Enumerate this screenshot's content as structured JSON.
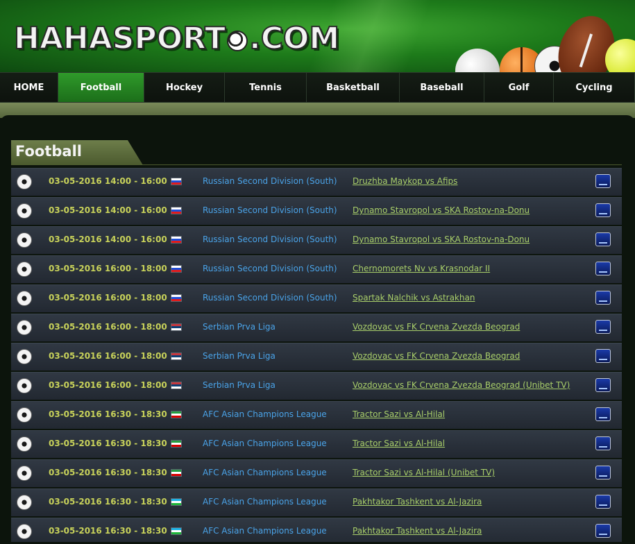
{
  "header": {
    "logo_text_left": "HAHASPORT",
    "logo_text_right": ".COM"
  },
  "nav": [
    {
      "label": "HOME",
      "active": false
    },
    {
      "label": "Football",
      "active": true
    },
    {
      "label": "Hockey",
      "active": false
    },
    {
      "label": "Tennis",
      "active": false
    },
    {
      "label": "Basketball",
      "active": false
    },
    {
      "label": "Baseball",
      "active": false
    },
    {
      "label": "Golf",
      "active": false
    },
    {
      "label": "Cycling",
      "active": false
    }
  ],
  "section": {
    "title": "Football"
  },
  "flag_colors": {
    "russia": [
      "#ffffff",
      "#1f4fd8",
      "#e21b1b"
    ],
    "serbia": [
      "#c6363c",
      "#0c4076",
      "#ffffff"
    ],
    "iran": [
      "#239f40",
      "#ffffff",
      "#da0000"
    ],
    "uzbekistan": [
      "#1eb4e6",
      "#ffffff",
      "#1eb53a"
    ]
  },
  "events": [
    {
      "time": "03-05-2016 14:00 - 16:00",
      "flag": "russia",
      "league": "Russian Second Division (South)",
      "match": "Druzhba Maykop vs Afips"
    },
    {
      "time": "03-05-2016 14:00 - 16:00",
      "flag": "russia",
      "league": "Russian Second Division (South)",
      "match": "Dynamo Stavropol vs SKA Rostov-na-Donu"
    },
    {
      "time": "03-05-2016 14:00 - 16:00",
      "flag": "russia",
      "league": "Russian Second Division (South)",
      "match": "Dynamo Stavropol vs SKA Rostov-na-Donu"
    },
    {
      "time": "03-05-2016 16:00 - 18:00",
      "flag": "russia",
      "league": "Russian Second Division (South)",
      "match": "Chernomorets Nv vs Krasnodar II"
    },
    {
      "time": "03-05-2016 16:00 - 18:00",
      "flag": "russia",
      "league": "Russian Second Division (South)",
      "match": "Spartak Nalchik vs Astrakhan"
    },
    {
      "time": "03-05-2016 16:00 - 18:00",
      "flag": "serbia",
      "league": "Serbian Prva Liga",
      "match": "Vozdovac vs FK Crvena Zvezda Beograd"
    },
    {
      "time": "03-05-2016 16:00 - 18:00",
      "flag": "serbia",
      "league": "Serbian Prva Liga",
      "match": "Vozdovac vs FK Crvena Zvezda Beograd"
    },
    {
      "time": "03-05-2016 16:00 - 18:00",
      "flag": "serbia",
      "league": "Serbian Prva Liga",
      "match": "Vozdovac vs FK Crvena Zvezda Beograd (Unibet TV)"
    },
    {
      "time": "03-05-2016 16:30 - 18:30",
      "flag": "iran",
      "league": "AFC Asian Champions League",
      "match": "Tractor Sazi vs Al-Hilal"
    },
    {
      "time": "03-05-2016 16:30 - 18:30",
      "flag": "iran",
      "league": "AFC Asian Champions League",
      "match": "Tractor Sazi vs Al-Hilal"
    },
    {
      "time": "03-05-2016 16:30 - 18:30",
      "flag": "iran",
      "league": "AFC Asian Champions League",
      "match": "Tractor Sazi vs Al-Hilal (Unibet TV)"
    },
    {
      "time": "03-05-2016 16:30 - 18:30",
      "flag": "uzbekistan",
      "league": "AFC Asian Champions League",
      "match": "Pakhtakor Tashkent vs Al-Jazira"
    },
    {
      "time": "03-05-2016 16:30 - 18:30",
      "flag": "uzbekistan",
      "league": "AFC Asian Champions League",
      "match": "Pakhtakor Tashkent vs Al-Jazira"
    }
  ]
}
